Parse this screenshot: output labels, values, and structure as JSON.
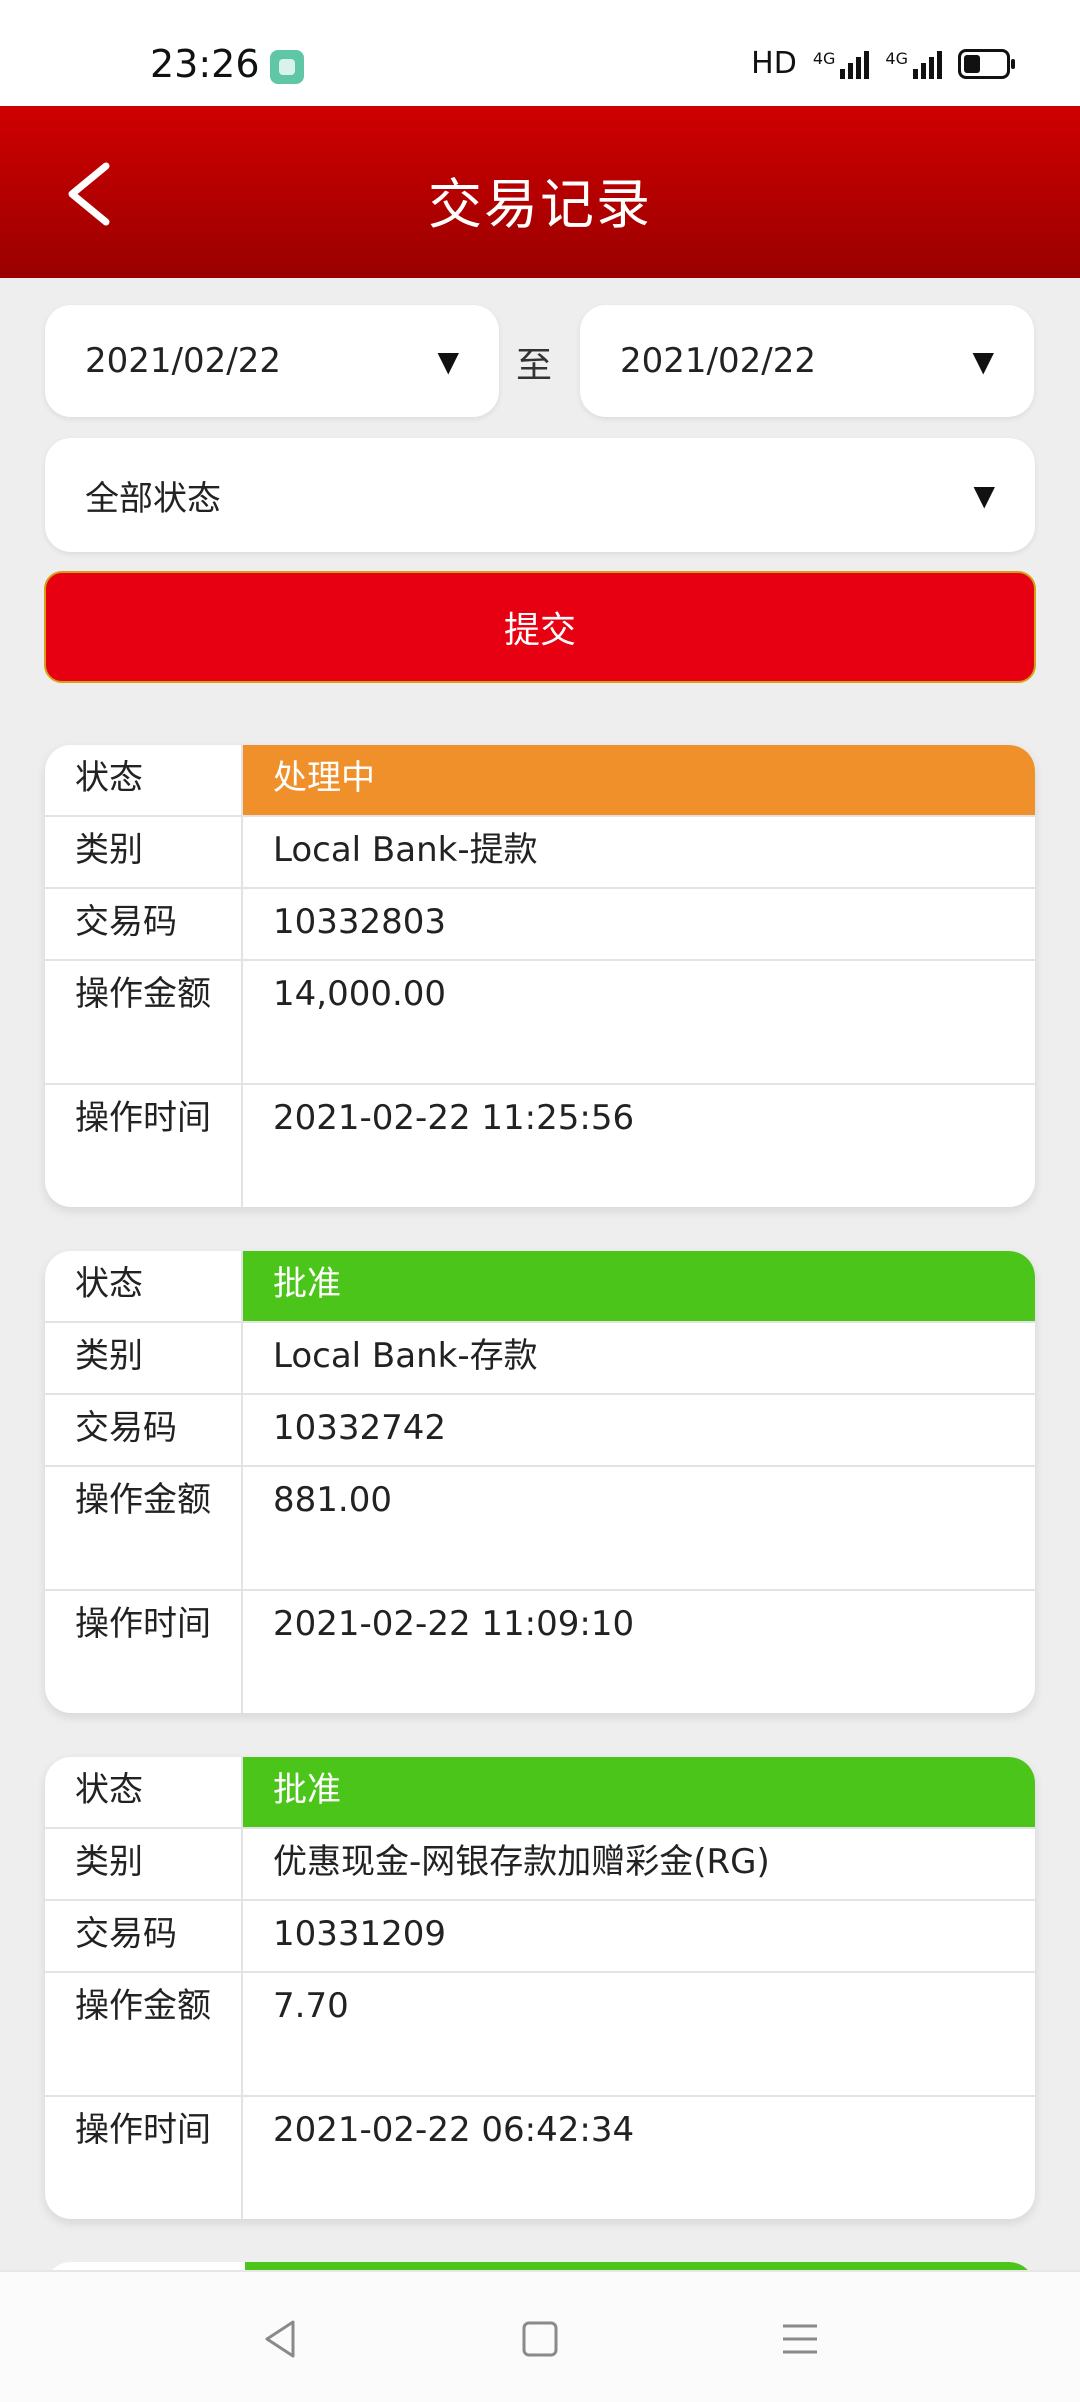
{
  "status_bar": {
    "time": "23:26",
    "network_label": "HD",
    "signal_1_label": "4G",
    "signal_2_label": "4G",
    "icons": [
      "app-icon",
      "signal-icon",
      "battery-icon"
    ]
  },
  "header": {
    "title": "交易记录",
    "back_icon": "chevron-left-icon",
    "color_top": "#cf0000",
    "color_bottom": "#9a0000"
  },
  "filters": {
    "start_date": "2021/02/22",
    "end_date": "2021/02/22",
    "to_label": "至",
    "status_value": "全部状态",
    "dropdown_arrow": "▼",
    "submit_label": "提交",
    "submit_color": "#e60012"
  },
  "record_labels": {
    "status": "状态",
    "type": "类别",
    "code": "交易码",
    "amount": "操作金额",
    "time": "操作时间"
  },
  "records": [
    {
      "status": "处理中",
      "status_color": "#f0902a",
      "type": "Local Bank-提款",
      "code": "10332803",
      "amount": "14,000.00",
      "time": "2021-02-22 11:25:56"
    },
    {
      "status": "批准",
      "status_color": "#4cc51a",
      "type": "Local Bank-存款",
      "code": "10332742",
      "amount": "881.00",
      "time": "2021-02-22 11:09:10"
    },
    {
      "status": "批准",
      "status_color": "#4cc51a",
      "type": "优惠现金-网银存款加赠彩金(RG)",
      "code": "10331209",
      "amount": "7.70",
      "time": "2021-02-22 06:42:34"
    }
  ],
  "nav_bar": {
    "icons": [
      "back-triangle-icon",
      "home-square-icon",
      "menu-lines-icon"
    ]
  }
}
